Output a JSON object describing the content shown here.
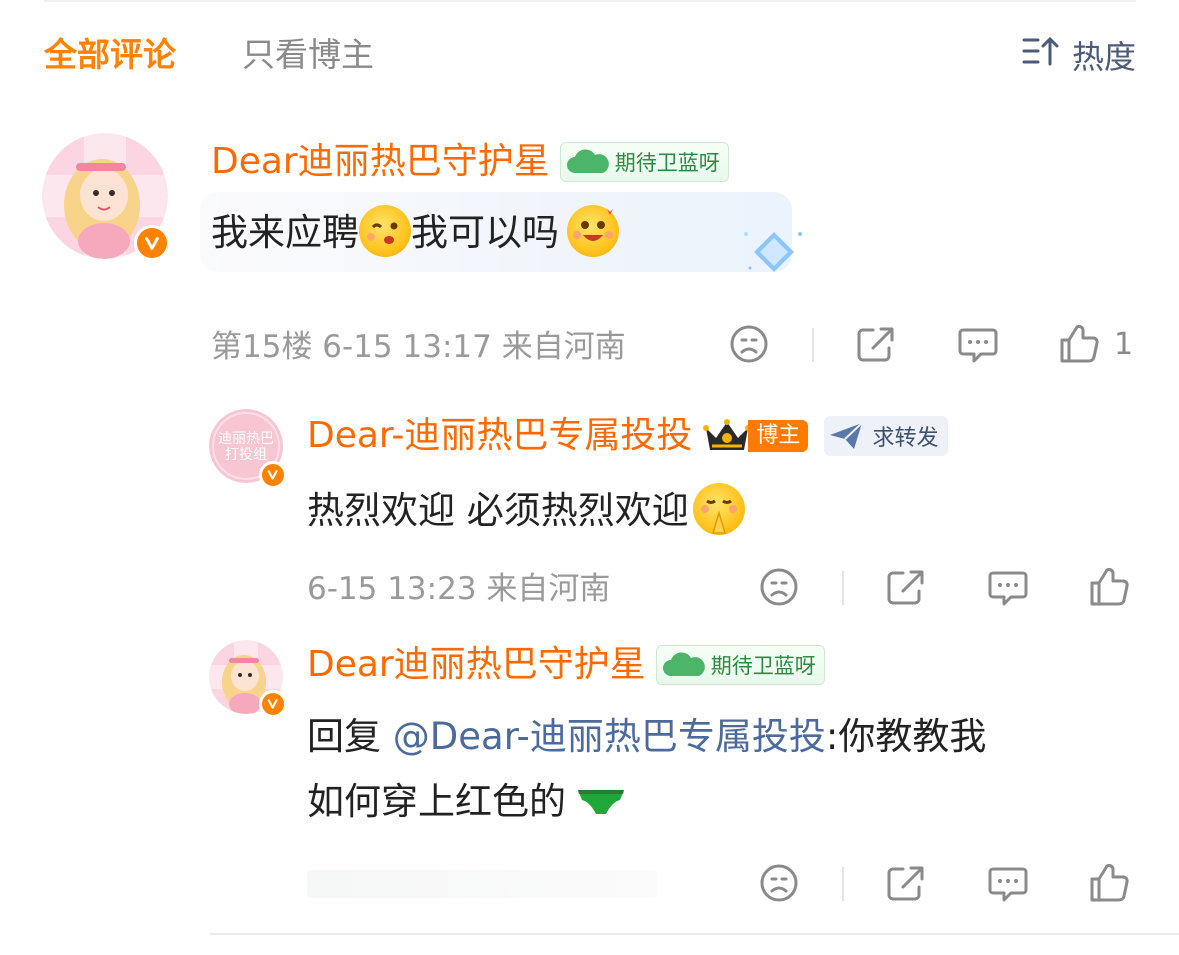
{
  "tabs": {
    "all_comments": "全部评论",
    "host_only": "只看博主",
    "sort_label": "热度"
  },
  "comments": [
    {
      "username": "Dear迪丽热巴守护星",
      "badge": "期待卫蓝呀",
      "text_part1": "我来应聘",
      "text_part2": "我可以吗",
      "meta": "第15楼  6-15 13:17  来自河南",
      "like_count": "1"
    },
    {
      "username": "Dear-迪丽热巴专属投投",
      "host_badge": "博主",
      "forward_badge": "求转发",
      "text": "热烈欢迎 必须热烈欢迎",
      "avatar_text_line1": "迪丽热巴",
      "avatar_text_line2": "打投组",
      "meta": "6-15 13:23  来自河南"
    },
    {
      "username": "Dear迪丽热巴守护星",
      "badge": "期待卫蓝呀",
      "reply_prefix": "回复 ",
      "mention": "@Dear-迪丽热巴专属投投",
      "text_line1": ":你教教我",
      "text_line2": "如何穿上红色的"
    }
  ],
  "icons": {
    "sort": "sort-icon",
    "dislike": "sad-face-icon",
    "share": "share-icon",
    "comment": "comment-bubble-icon",
    "like": "thumbs-up-icon",
    "verified": "verified-v-icon"
  },
  "colors": {
    "accent_orange": "#ff8200",
    "username_orange": "#ff6a00",
    "mention_blue": "#4c6a9b",
    "badge_green": "#2c8a44"
  }
}
